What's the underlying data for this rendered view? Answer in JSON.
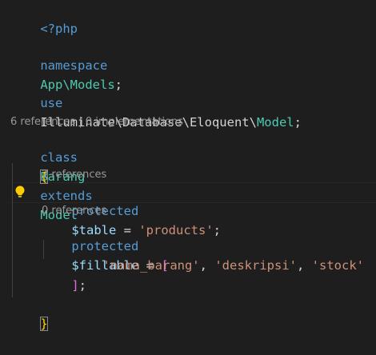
{
  "editor": {
    "language": "php",
    "lines": {
      "php_open": "<?php",
      "ns_kw": "namespace",
      "ns_name": "App\\Models",
      "ns_semi": ";",
      "use_kw": "use",
      "use_path": "Illuminate\\Database\\Eloquent\\",
      "use_class": "Model",
      "use_semi": ";",
      "class_kw": "class",
      "class_name": "Barang",
      "extends_kw": "extends",
      "parent_class": "Model",
      "open_brace": "{",
      "table_protected": "protected",
      "table_var": "$table",
      "table_eq": " = ",
      "table_val": "'products'",
      "table_semi": ";",
      "fillable_protected": "protected",
      "fillable_var": "$fillable",
      "fillable_eq": " = ",
      "fillable_open": "[",
      "item1": "'nama_barang'",
      "comma1": ", ",
      "item2": "'deskripsi'",
      "comma2": ", ",
      "item3": "'stock'",
      "fillable_close": "]",
      "fillable_semi": ";",
      "close_brace": "}"
    },
    "codelens": {
      "class_refs": "6 references | 0 implementations",
      "table_refs": "2 references",
      "fillable_refs": "0 references"
    },
    "colors": {
      "background": "#1e1e1e",
      "keyword": "#569cd6",
      "type": "#4ec9b0",
      "variable": "#9cdcfe",
      "string": "#ce9178",
      "bracket": "#da70d6",
      "brace": "#ffd700",
      "lightbulb": "#ffcc00"
    },
    "icons": [
      "lightbulb-icon"
    ]
  }
}
